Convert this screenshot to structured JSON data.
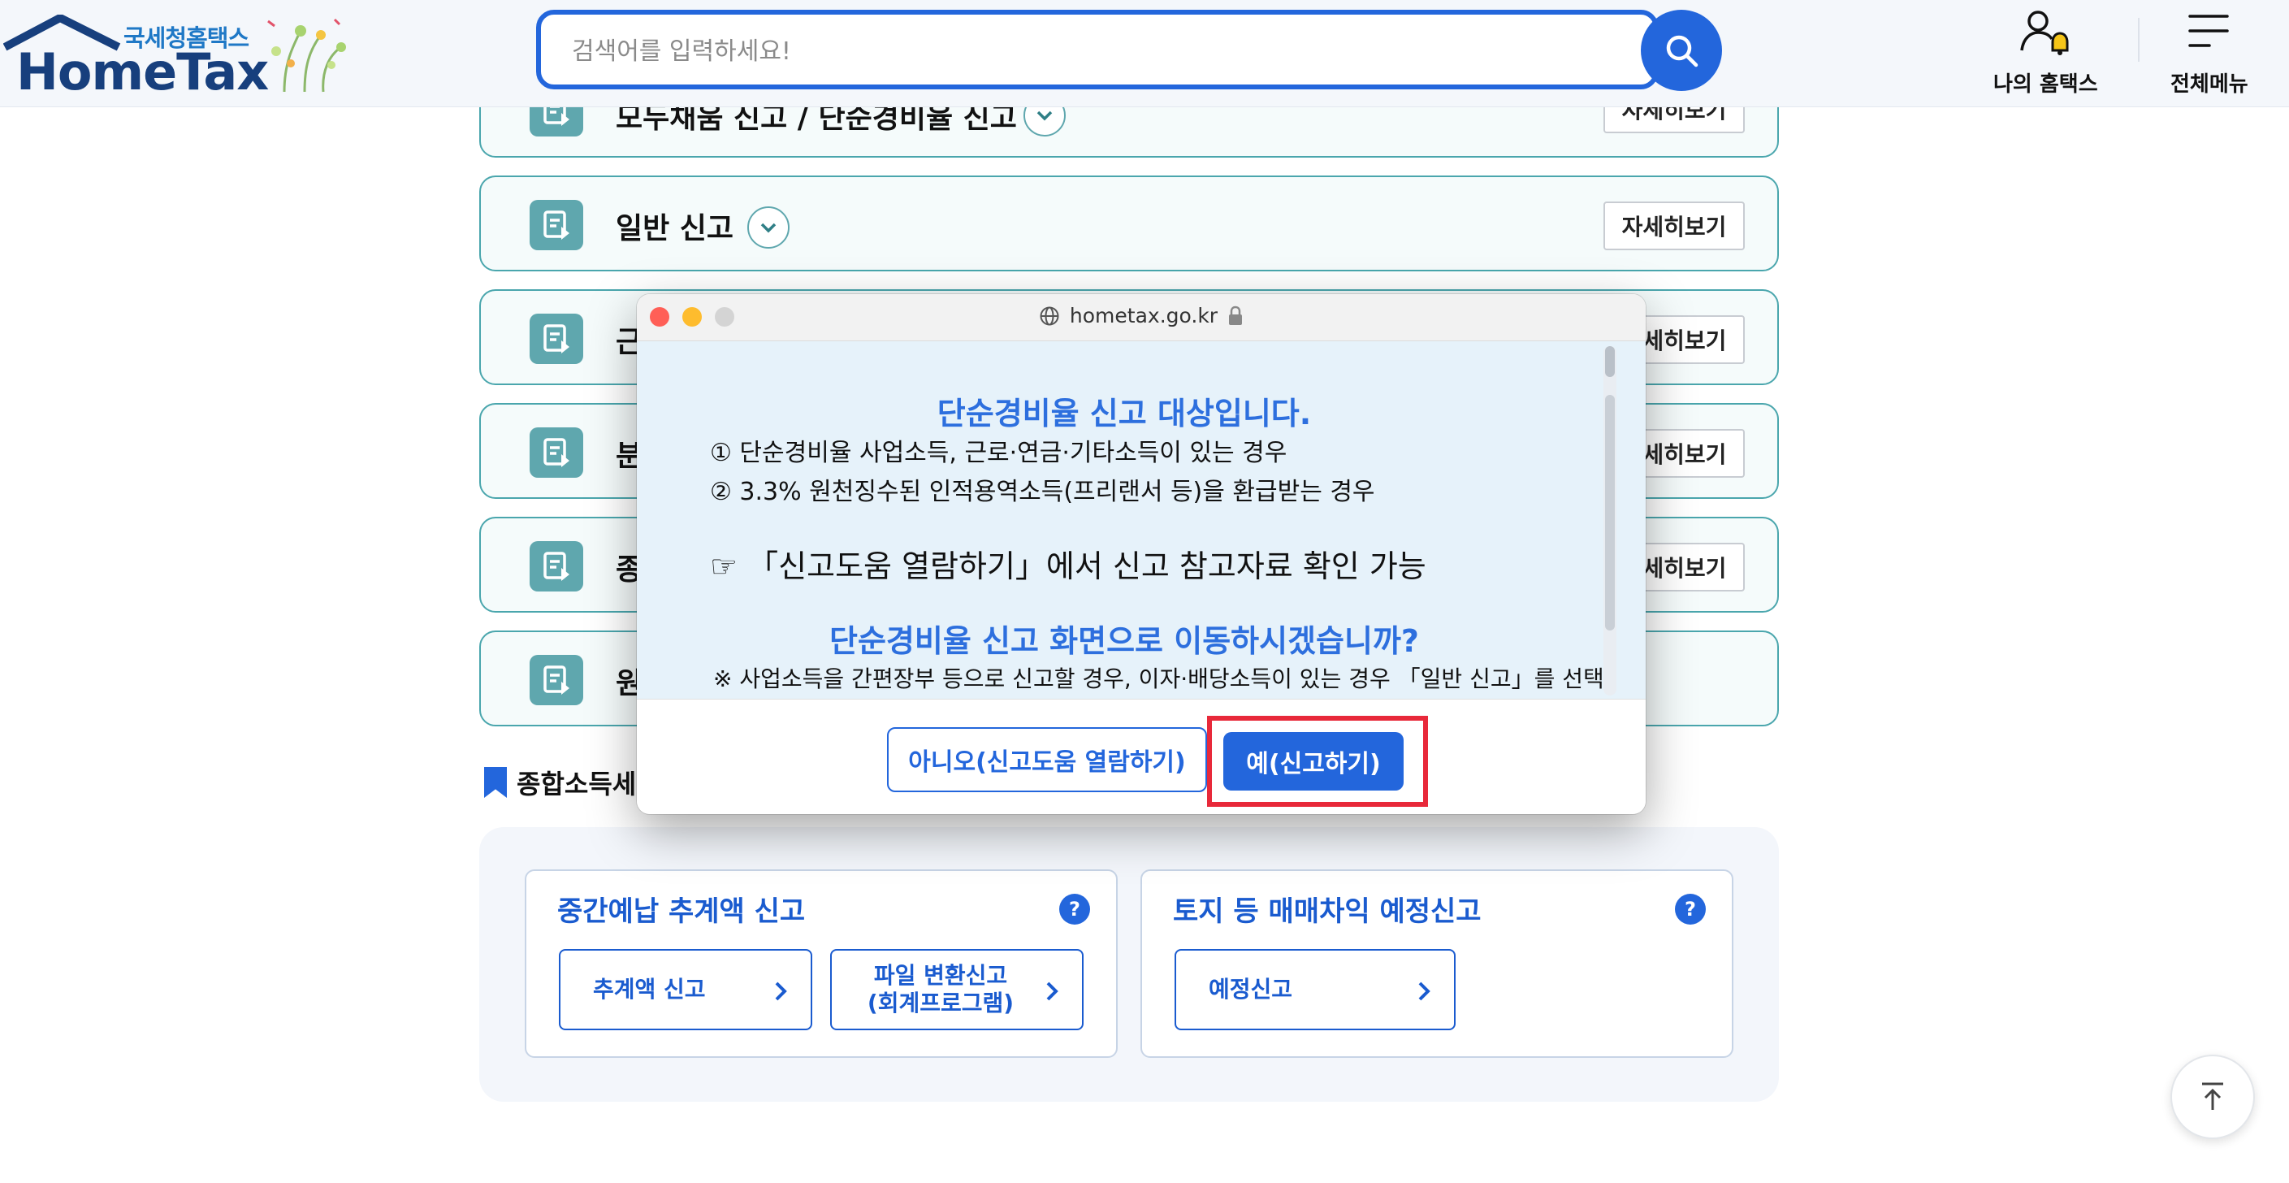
{
  "header": {
    "logo_sub": "국세청홈택스",
    "logo_main": "HomeTax",
    "search_placeholder": "검색어를 입력하세요!",
    "my_hometax": "나의 홈택스",
    "all_menu": "전체메뉴"
  },
  "rows": [
    {
      "title": "모두채움 신고 / 단순경비율 신고",
      "more": "자세히보기"
    },
    {
      "title": "일반 신고",
      "more": "자세히보기"
    },
    {
      "title": "근",
      "more": "자세히보기"
    },
    {
      "title": "분",
      "more": "자세히보기"
    },
    {
      "title": "종",
      "more": "자세히보기"
    },
    {
      "title": "원"
    }
  ],
  "section": {
    "title": "종합소득세"
  },
  "cards": [
    {
      "title": "중간예납 추계액 신고",
      "help": "?",
      "buttons": [
        "추계액 신고",
        "파일 변환신고\n(회계프로그램)"
      ]
    },
    {
      "title": "토지 등 매매차익 예정신고",
      "help": "?",
      "buttons": [
        "예정신고"
      ]
    }
  ],
  "popup": {
    "url": "hometax.go.kr",
    "heading": "단순경비율 신고 대상입니다.",
    "line1": "① 단순경비율 사업소득, 근로·연금·기타소득이 있는 경우",
    "line2": "② 3.3% 원천징수된 인적용역소득(프리랜서 등)을 환급받는 경우",
    "hint": "☞ 「신고도움 열람하기」에서 신고 참고자료 확인 가능",
    "question": "단순경비율 신고 화면으로 이동하시겠습니까?",
    "note": "※ 사업소득을 간편장부 등으로 신고할 경우, 이자·배당소득이 있는 경우 「일반 신고」를 선택",
    "btn_no": "아니오(신고도움 열람하기)",
    "btn_yes": "예(신고하기)"
  },
  "colors": {
    "accent": "#2366dc",
    "teal": "#4aa6ad",
    "highlight": "#e8293a"
  },
  "icons": [
    "search-icon",
    "user-bell-icon",
    "hamburger-icon",
    "document-icon",
    "chevron-down-icon",
    "chevron-right-icon",
    "bookmark-icon",
    "arrow-up-icon",
    "globe-icon",
    "lock-icon"
  ]
}
